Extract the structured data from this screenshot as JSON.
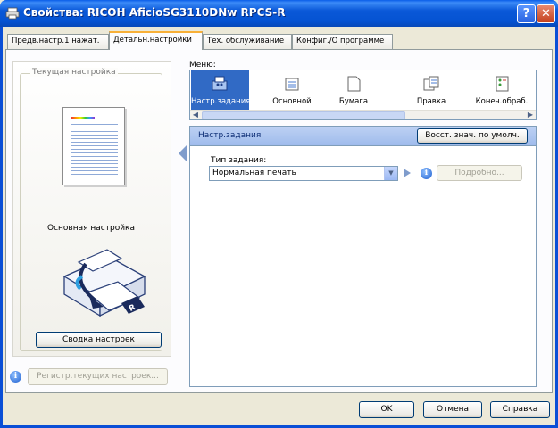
{
  "window": {
    "title": "Свойства: RICOH AficioSG3110DNw RPCS-R",
    "help_btn": "?",
    "close_btn": "✕"
  },
  "tabs": [
    {
      "label": "Предв.настр.1 нажат.",
      "active": false
    },
    {
      "label": "Детальн.настройки",
      "active": true
    },
    {
      "label": "Тех. обслуживание",
      "active": false
    },
    {
      "label": "Конфиг./О программе",
      "active": false
    }
  ],
  "left_panel": {
    "group_label": "Текущая настройка",
    "preview_label": "Основная настройка",
    "summary_button": "Сводка настроек",
    "register_button": "Регистр.текущих настроек..."
  },
  "menu": {
    "label": "Меню:",
    "items": [
      {
        "label": "Настр.задания",
        "icon": "job-settings-icon",
        "selected": true
      },
      {
        "label": "Основной",
        "icon": "basic-icon",
        "selected": false
      },
      {
        "label": "Бумага",
        "icon": "paper-icon",
        "selected": false
      },
      {
        "label": "Правка",
        "icon": "edit-icon",
        "selected": false
      },
      {
        "label": "Конеч.обраб.",
        "icon": "finishing-icon",
        "selected": false
      }
    ]
  },
  "settings": {
    "title": "Настр.задания",
    "restore_button": "Восст. знач. по умолч.",
    "job_type_label": "Тип задания:",
    "job_type_value": "Нормальная печать",
    "details_button": "Подробно..."
  },
  "footer": {
    "ok": "OK",
    "cancel": "Отмена",
    "help": "Справка"
  },
  "colors": {
    "titlebar": "#0a58d8",
    "selection": "#316ac5",
    "header": "#bdd1f3"
  }
}
